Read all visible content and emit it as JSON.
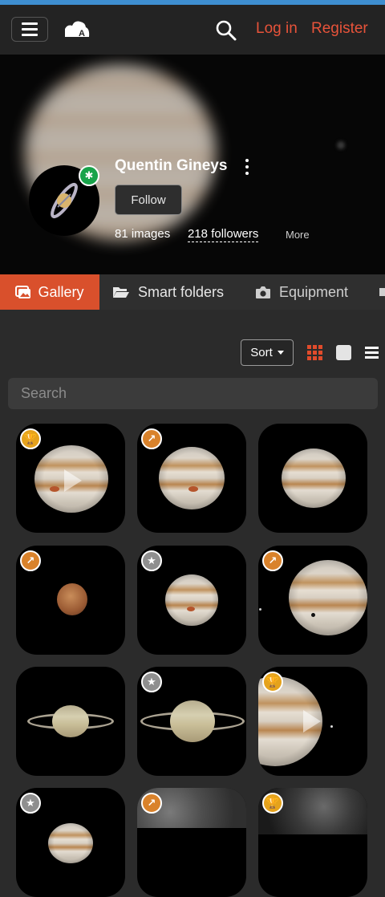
{
  "nav": {
    "login": "Log in",
    "register": "Register",
    "menu_icon": "hamburger-icon",
    "logo_icon": "astrobin-logo-icon",
    "search_icon": "search-icon",
    "accent_color": "#e8533a"
  },
  "profile": {
    "name": "Quentin Gineys",
    "follow": "Follow",
    "images": "81 images",
    "followers": "218 followers",
    "more": "More",
    "online_badge": "✱"
  },
  "tabs": [
    {
      "label": "Gallery",
      "icon": "image-icon",
      "active": true
    },
    {
      "label": "Smart folders",
      "icon": "folder-open-icon",
      "active": false
    },
    {
      "label": "Equipment",
      "icon": "camera-icon",
      "active": false
    }
  ],
  "toolbar": {
    "sort": "Sort",
    "search_placeholder": "Search"
  },
  "gallery": [
    {
      "subject": "jupiter",
      "badge": "trophy",
      "video": true
    },
    {
      "subject": "jupiter",
      "badge": "top-pick",
      "video": false
    },
    {
      "subject": "jupiter",
      "badge": "",
      "video": false
    },
    {
      "subject": "mars",
      "badge": "top-pick",
      "video": false
    },
    {
      "subject": "jupiter",
      "badge": "star",
      "video": false
    },
    {
      "subject": "jupiter",
      "badge": "top-pick",
      "video": false
    },
    {
      "subject": "saturn",
      "badge": "",
      "video": false
    },
    {
      "subject": "saturn",
      "badge": "star",
      "video": false
    },
    {
      "subject": "jupiter",
      "badge": "trophy",
      "video": true
    },
    {
      "subject": "saturn",
      "badge": "star",
      "video": false
    },
    {
      "subject": "moon",
      "badge": "top-pick",
      "video": false
    },
    {
      "subject": "moon",
      "badge": "trophy",
      "video": false
    }
  ]
}
